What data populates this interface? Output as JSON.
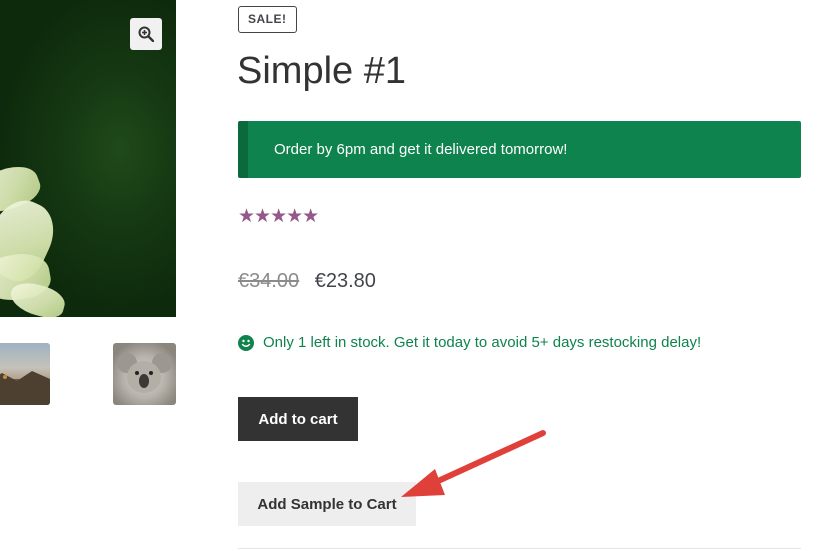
{
  "product": {
    "sale_badge": "SALE!",
    "title": "Simple #1",
    "notice": "Order by 6pm and get it delivered tomorrow!",
    "rating": {
      "value": 5,
      "max": 5,
      "stars": "★★★★★"
    },
    "price": {
      "old": "€34.00",
      "new": "€23.80"
    },
    "stock_message": "Only 1 left in stock. Get it today to avoid 5+ days restocking delay!",
    "add_to_cart_label": "Add to cart",
    "add_sample_label": "Add Sample to Cart"
  },
  "gallery": {
    "zoom_icon": "zoom-in-icon",
    "thumbnails": [
      "landscape-thumbnail",
      "koala-thumbnail"
    ]
  },
  "colors": {
    "notice_bg": "#0f834d",
    "stars": "#96588a",
    "stock_text": "#0f834d",
    "primary_button": "#333333",
    "annotation_arrow": "#e0403a"
  }
}
